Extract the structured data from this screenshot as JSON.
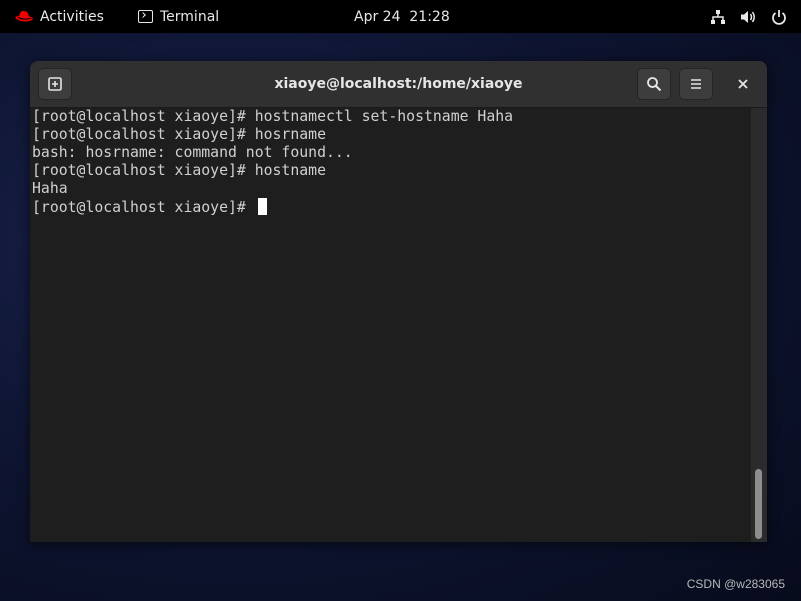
{
  "topbar": {
    "activities_label": "Activities",
    "app_label": "Terminal",
    "clock": "Apr 24  21:28",
    "icons": [
      "network-icon",
      "volume-icon",
      "power-icon"
    ]
  },
  "window": {
    "title": "xiaoye@localhost:/home/xiaoye",
    "buttons": [
      "new-tab-icon",
      "search-icon",
      "menu-icon",
      "close-icon"
    ]
  },
  "terminal": {
    "lines": [
      "[root@localhost xiaoye]# hostnamectl set-hostname Haha",
      "[root@localhost xiaoye]# hosrname",
      "bash: hosrname: command not found...",
      "[root@localhost xiaoye]# hostname",
      "Haha",
      "[root@localhost xiaoye]# "
    ]
  },
  "watermark": "CSDN @w283065",
  "colors": {
    "accent_red": "#ee0000",
    "terminal_bg": "#1e1e1e",
    "headerbar_bg": "#303030"
  }
}
